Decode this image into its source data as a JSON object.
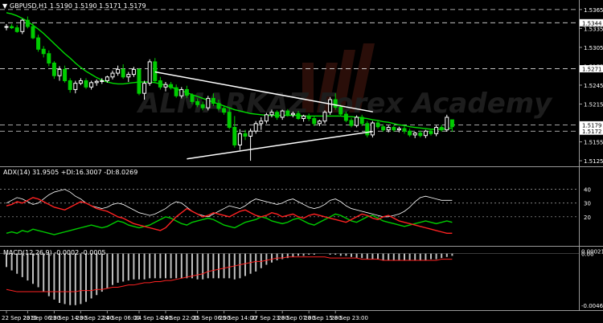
{
  "header": {
    "symbol": "GBPUSD,H1",
    "ohlc": "1.5190 1.5190 1.5171 1.5179"
  },
  "watermark": "ALMARKAZ Forex Academy",
  "colors": {
    "background": "#000000",
    "bull_candle": "#ffffff",
    "bear_candle": "#00cc00",
    "moving_average": "#00dd00",
    "adx": "#ffffff",
    "plus_di": "#00cc00",
    "minus_di": "#ff2222",
    "macd_hist": "#c0c0c0",
    "macd_signal": "#ff2222",
    "trendline": "#ffffff",
    "axis_label_box": "#ffffff"
  },
  "chart_data": [
    {
      "name": "price",
      "type": "candlestick",
      "ylim": [
        1.512,
        1.5375
      ],
      "y_ticks": [
        "1.5365",
        "1.5335",
        "1.5305",
        "1.5275",
        "1.5245",
        "1.5215",
        "1.5185",
        "1.5155",
        "1.5125"
      ],
      "price_tags": [
        {
          "label": "1.5344",
          "value": 1.5344
        },
        {
          "label": "1.5271",
          "value": 1.5271
        },
        {
          "label": "1.5179",
          "value": 1.5182
        },
        {
          "label": "1.5172",
          "value": 1.5172
        }
      ],
      "horizontal_lines": [
        1.5365,
        1.5344,
        1.5271,
        1.5182,
        1.5172
      ],
      "candles": [
        [
          1.5337,
          1.5342,
          1.5332,
          1.5338
        ],
        [
          1.5338,
          1.5342,
          1.5334,
          1.5336
        ],
        [
          1.5336,
          1.534,
          1.5328,
          1.533
        ],
        [
          1.533,
          1.535,
          1.5326,
          1.5348
        ],
        [
          1.5348,
          1.5354,
          1.5335,
          1.5338
        ],
        [
          1.5338,
          1.5343,
          1.5318,
          1.532
        ],
        [
          1.532,
          1.5325,
          1.5298,
          1.5302
        ],
        [
          1.5302,
          1.5307,
          1.5289,
          1.5295
        ],
        [
          1.5295,
          1.53,
          1.5275,
          1.528
        ],
        [
          1.528,
          1.5283,
          1.5255,
          1.526
        ],
        [
          1.526,
          1.5275,
          1.5252,
          1.527
        ],
        [
          1.527,
          1.5276,
          1.5249,
          1.5252
        ],
        [
          1.5252,
          1.5256,
          1.5233,
          1.5238
        ],
        [
          1.5238,
          1.5252,
          1.5232,
          1.5248
        ],
        [
          1.5248,
          1.5256,
          1.5245,
          1.5252
        ],
        [
          1.5252,
          1.5256,
          1.5239,
          1.5242
        ],
        [
          1.5242,
          1.5252,
          1.5238,
          1.5249
        ],
        [
          1.5249,
          1.5254,
          1.5244,
          1.5251
        ],
        [
          1.5251,
          1.5256,
          1.5247,
          1.5252
        ],
        [
          1.5252,
          1.526,
          1.5249,
          1.5258
        ],
        [
          1.5258,
          1.5268,
          1.5254,
          1.5264
        ],
        [
          1.5264,
          1.5276,
          1.526,
          1.527
        ],
        [
          1.527,
          1.5278,
          1.5255,
          1.5258
        ],
        [
          1.5258,
          1.5266,
          1.525,
          1.5262
        ],
        [
          1.5262,
          1.5274,
          1.5258,
          1.527
        ],
        [
          1.527,
          1.5272,
          1.5229,
          1.5232
        ],
        [
          1.5232,
          1.5252,
          1.5222,
          1.5248
        ],
        [
          1.5248,
          1.5286,
          1.5244,
          1.5282
        ],
        [
          1.5282,
          1.5288,
          1.5248,
          1.5252
        ],
        [
          1.5252,
          1.5258,
          1.5238,
          1.5242
        ],
        [
          1.5242,
          1.525,
          1.5235,
          1.5246
        ],
        [
          1.5246,
          1.525,
          1.5238,
          1.5241
        ],
        [
          1.5241,
          1.5246,
          1.5225,
          1.5228
        ],
        [
          1.5228,
          1.5242,
          1.5224,
          1.5238
        ],
        [
          1.5238,
          1.5244,
          1.5225,
          1.5229
        ],
        [
          1.5229,
          1.5232,
          1.5215,
          1.5219
        ],
        [
          1.5219,
          1.5224,
          1.521,
          1.5214
        ],
        [
          1.5214,
          1.5219,
          1.5205,
          1.5209
        ],
        [
          1.5209,
          1.5228,
          1.5205,
          1.5224
        ],
        [
          1.5224,
          1.5232,
          1.5212,
          1.5216
        ],
        [
          1.5216,
          1.5222,
          1.5205,
          1.5208
        ],
        [
          1.5208,
          1.5213,
          1.5198,
          1.5202
        ],
        [
          1.5202,
          1.5208,
          1.5175,
          1.5178
        ],
        [
          1.5178,
          1.5196,
          1.5146,
          1.515
        ],
        [
          1.515,
          1.5175,
          1.5142,
          1.5168
        ],
        [
          1.5168,
          1.5174,
          1.5158,
          1.5164
        ],
        [
          1.5164,
          1.5176,
          1.5125,
          1.5172
        ],
        [
          1.5172,
          1.5188,
          1.5168,
          1.5184
        ],
        [
          1.5184,
          1.5194,
          1.5174,
          1.5188
        ],
        [
          1.5188,
          1.5201,
          1.5184,
          1.5198
        ],
        [
          1.5198,
          1.5206,
          1.5194,
          1.5202
        ],
        [
          1.5202,
          1.5205,
          1.519,
          1.5194
        ],
        [
          1.5194,
          1.5206,
          1.519,
          1.5204
        ],
        [
          1.5204,
          1.5207,
          1.5195,
          1.5198
        ],
        [
          1.5198,
          1.5203,
          1.5194,
          1.52
        ],
        [
          1.52,
          1.5204,
          1.519,
          1.5192
        ],
        [
          1.5192,
          1.5198,
          1.5187,
          1.5196
        ],
        [
          1.5196,
          1.52,
          1.5188,
          1.5192
        ],
        [
          1.5192,
          1.5196,
          1.518,
          1.5184
        ],
        [
          1.5184,
          1.519,
          1.518,
          1.5188
        ],
        [
          1.5188,
          1.5205,
          1.5184,
          1.5202
        ],
        [
          1.5202,
          1.5226,
          1.5198,
          1.5222
        ],
        [
          1.5222,
          1.5232,
          1.5206,
          1.521
        ],
        [
          1.521,
          1.5214,
          1.5196,
          1.5199
        ],
        [
          1.5199,
          1.5203,
          1.5186,
          1.5189
        ],
        [
          1.5189,
          1.5193,
          1.5178,
          1.5181
        ],
        [
          1.5181,
          1.5197,
          1.5178,
          1.5194
        ],
        [
          1.5194,
          1.5198,
          1.518,
          1.5184
        ],
        [
          1.5184,
          1.5188,
          1.5162,
          1.5166
        ],
        [
          1.5166,
          1.5188,
          1.5162,
          1.5185
        ],
        [
          1.5185,
          1.5189,
          1.5176,
          1.5179
        ],
        [
          1.5179,
          1.5183,
          1.5171,
          1.5174
        ],
        [
          1.5174,
          1.5181,
          1.517,
          1.5178
        ],
        [
          1.5178,
          1.5181,
          1.5171,
          1.5174
        ],
        [
          1.5174,
          1.5179,
          1.517,
          1.5176
        ],
        [
          1.5176,
          1.518,
          1.5168,
          1.5172
        ],
        [
          1.5172,
          1.5176,
          1.5163,
          1.5166
        ],
        [
          1.5166,
          1.5171,
          1.5161,
          1.5169
        ],
        [
          1.5169,
          1.5173,
          1.5162,
          1.5165
        ],
        [
          1.5165,
          1.5174,
          1.5161,
          1.5172
        ],
        [
          1.5172,
          1.5176,
          1.5165,
          1.5168
        ],
        [
          1.5168,
          1.5181,
          1.5164,
          1.5178
        ],
        [
          1.5178,
          1.5182,
          1.5171,
          1.5174
        ],
        [
          1.5174,
          1.5198,
          1.5171,
          1.5194
        ],
        [
          1.519,
          1.519,
          1.5171,
          1.5179
        ]
      ],
      "moving_average": [
        1.536,
        1.5358,
        1.5355,
        1.5351,
        1.5346,
        1.534,
        1.5334,
        1.5327,
        1.5319,
        1.5311,
        1.5303,
        1.5295,
        1.5288,
        1.528,
        1.5273,
        1.5267,
        1.5262,
        1.5257,
        1.5253,
        1.525,
        1.5248,
        1.5247,
        1.5247,
        1.5248,
        1.5249,
        1.525,
        1.525,
        1.525,
        1.5249,
        1.5247,
        1.5245,
        1.5242,
        1.5239,
        1.5236,
        1.5233,
        1.523,
        1.5227,
        1.5224,
        1.5221,
        1.5218,
        1.5215,
        1.5212,
        1.5209,
        1.5206,
        1.5204,
        1.5202,
        1.52,
        1.5199,
        1.5198,
        1.5197,
        1.5197,
        1.5197,
        1.5197,
        1.5197,
        1.5197,
        1.5197,
        1.5196,
        1.5196,
        1.5196,
        1.5196,
        1.5196,
        1.5196,
        1.5196,
        1.5196,
        1.5195,
        1.5195,
        1.5194,
        1.5193,
        1.5192,
        1.519,
        1.5189,
        1.5187,
        1.5186,
        1.5184,
        1.5182,
        1.5181,
        1.5179,
        1.5178,
        1.5177,
        1.5176,
        1.5175,
        1.5175,
        1.5175,
        1.5176,
        1.5177
      ],
      "trendlines": [
        {
          "from": [
            28,
            1.5266
          ],
          "to": [
            63,
            1.5212
          ]
        },
        {
          "from": [
            34,
            1.5128
          ],
          "to": [
            63,
            1.5164
          ]
        }
      ]
    },
    {
      "name": "adx",
      "type": "line",
      "label": "ADX(14) 31.9505 +DI:16.3007 -DI:8.0269",
      "ylim": [
        0,
        55
      ],
      "y_ticks": [
        "40",
        "30",
        "20"
      ],
      "dashed_levels": [
        40,
        30,
        20
      ],
      "series": [
        {
          "values": [
            30,
            32,
            34,
            33,
            31,
            29,
            30,
            33,
            36,
            38,
            39,
            40,
            38,
            35,
            33,
            30,
            28,
            27,
            26,
            27,
            29,
            30,
            29,
            27,
            25,
            23,
            22,
            21,
            22,
            24,
            26,
            29,
            31,
            30,
            27,
            24,
            22,
            21,
            20,
            22,
            24,
            26,
            28,
            27,
            26,
            28,
            31,
            33,
            32,
            31,
            30,
            29,
            30,
            32,
            33,
            31,
            29,
            27,
            26,
            27,
            29,
            32,
            33,
            31,
            28,
            26,
            25,
            24,
            23,
            22,
            21,
            20,
            20,
            21,
            22,
            24,
            27,
            31,
            34,
            35,
            34,
            33,
            32,
            32,
            32
          ]
        },
        {
          "values": [
            8,
            9,
            8,
            10,
            9,
            11,
            10,
            9,
            8,
            7,
            8,
            9,
            10,
            11,
            12,
            13,
            14,
            13,
            12,
            13,
            15,
            17,
            16,
            14,
            13,
            12,
            13,
            14,
            16,
            18,
            20,
            19,
            17,
            15,
            14,
            16,
            17,
            18,
            19,
            18,
            16,
            14,
            13,
            12,
            14,
            16,
            17,
            18,
            20,
            19,
            17,
            16,
            15,
            16,
            18,
            19,
            17,
            15,
            14,
            16,
            18,
            20,
            22,
            21,
            19,
            17,
            16,
            18,
            20,
            21,
            19,
            17,
            16,
            15,
            14,
            13,
            14,
            15,
            16,
            17,
            16,
            15,
            16,
            17,
            16
          ]
        },
        {
          "values": [
            28,
            29,
            31,
            30,
            32,
            34,
            33,
            31,
            29,
            27,
            26,
            25,
            27,
            29,
            31,
            30,
            28,
            26,
            25,
            24,
            22,
            20,
            19,
            17,
            15,
            14,
            13,
            12,
            11,
            10,
            12,
            16,
            20,
            23,
            26,
            24,
            22,
            20,
            21,
            23,
            22,
            21,
            20,
            22,
            24,
            25,
            23,
            21,
            20,
            21,
            23,
            22,
            20,
            21,
            22,
            20,
            19,
            21,
            22,
            21,
            20,
            19,
            18,
            17,
            16,
            18,
            20,
            22,
            21,
            19,
            18,
            20,
            21,
            19,
            17,
            16,
            15,
            14,
            13,
            12,
            11,
            10,
            9,
            8,
            8
          ]
        }
      ]
    },
    {
      "name": "macd",
      "type": "bar",
      "label": "MACD(12,26,9) -0.0002 -0.0005",
      "ylim": [
        -0.0049,
        0.0004
      ],
      "y_ticks": [
        "0.00021",
        "0.00",
        "-0.00462"
      ],
      "histogram": [
        -0.0012,
        -0.0015,
        -0.0018,
        -0.0021,
        -0.0024,
        -0.0027,
        -0.003,
        -0.0034,
        -0.0038,
        -0.0041,
        -0.0044,
        -0.0045,
        -0.0046,
        -0.0046,
        -0.0045,
        -0.0043,
        -0.004,
        -0.0037,
        -0.0034,
        -0.0031,
        -0.0028,
        -0.0026,
        -0.0025,
        -0.0024,
        -0.0023,
        -0.0023,
        -0.0023,
        -0.0022,
        -0.0022,
        -0.0022,
        -0.0022,
        -0.0022,
        -0.0022,
        -0.0022,
        -0.0022,
        -0.0022,
        -0.0023,
        -0.0023,
        -0.0022,
        -0.0022,
        -0.0022,
        -0.0022,
        -0.0022,
        -0.0023,
        -0.0022,
        -0.002,
        -0.0018,
        -0.0016,
        -0.0013,
        -0.001,
        -0.0008,
        -0.0006,
        -0.0005,
        -0.0004,
        -0.0003,
        -0.0002,
        -0.0002,
        -0.0001,
        -0.0001,
        0,
        0,
        -0.0001,
        -0.0001,
        -0.0002,
        -0.0002,
        -0.0003,
        -0.0004,
        -0.0004,
        -0.0005,
        -0.0005,
        -0.0005,
        -0.0006,
        -0.0006,
        -0.0006,
        -0.0006,
        -0.0006,
        -0.0006,
        -0.0006,
        -0.0006,
        -0.0006,
        -0.0005,
        -0.0005,
        -0.0004,
        -0.0003,
        -0.0002
      ],
      "signal": [
        -0.0032,
        -0.0033,
        -0.0034,
        -0.0034,
        -0.0034,
        -0.0034,
        -0.0034,
        -0.0034,
        -0.0034,
        -0.0034,
        -0.0034,
        -0.0034,
        -0.0034,
        -0.0034,
        -0.0033,
        -0.0033,
        -0.0033,
        -0.0032,
        -0.0032,
        -0.0031,
        -0.003,
        -0.003,
        -0.0029,
        -0.0028,
        -0.0028,
        -0.0027,
        -0.0026,
        -0.0026,
        -0.0025,
        -0.0025,
        -0.0024,
        -0.0024,
        -0.0023,
        -0.0022,
        -0.0021,
        -0.002,
        -0.0019,
        -0.0018,
        -0.0016,
        -0.0015,
        -0.0014,
        -0.0013,
        -0.0012,
        -0.0011,
        -0.001,
        -0.0009,
        -0.0008,
        -0.0007,
        -0.0007,
        -0.0006,
        -0.0005,
        -0.0004,
        -0.0004,
        -0.0003,
        -0.0003,
        -0.0003,
        -0.0003,
        -0.0003,
        -0.0003,
        -0.0003,
        -0.0003,
        -0.0004,
        -0.0004,
        -0.0004,
        -0.0004,
        -0.0004,
        -0.0004,
        -0.0005,
        -0.0005,
        -0.0005,
        -0.0005,
        -0.0006,
        -0.0006,
        -0.0006,
        -0.0006,
        -0.0006,
        -0.0006,
        -0.0006,
        -0.0006,
        -0.0006,
        -0.0006,
        -0.0006,
        -0.0005,
        -0.0005,
        -0.0005
      ]
    }
  ],
  "x_axis_labels": [
    {
      "label": "22 Sep 2015",
      "bar": 0
    },
    {
      "label": "23 Sep 06:00",
      "bar": 4
    },
    {
      "label": "23 Sep 14:00",
      "bar": 9
    },
    {
      "label": "23 Sep 22:00",
      "bar": 14
    },
    {
      "label": "24 Sep 06:00",
      "bar": 19
    },
    {
      "label": "24 Sep 14:00",
      "bar": 25
    },
    {
      "label": "24 Sep 22:00",
      "bar": 30
    },
    {
      "label": "25 Sep 06:00",
      "bar": 36
    },
    {
      "label": "25 Sep 14:00",
      "bar": 41
    },
    {
      "label": "27 Sep 23:00",
      "bar": 47
    },
    {
      "label": "28 Sep 07:00",
      "bar": 52
    },
    {
      "label": "28 Sep 15:00",
      "bar": 57
    },
    {
      "label": "28 Sep 23:00",
      "bar": 62
    }
  ]
}
